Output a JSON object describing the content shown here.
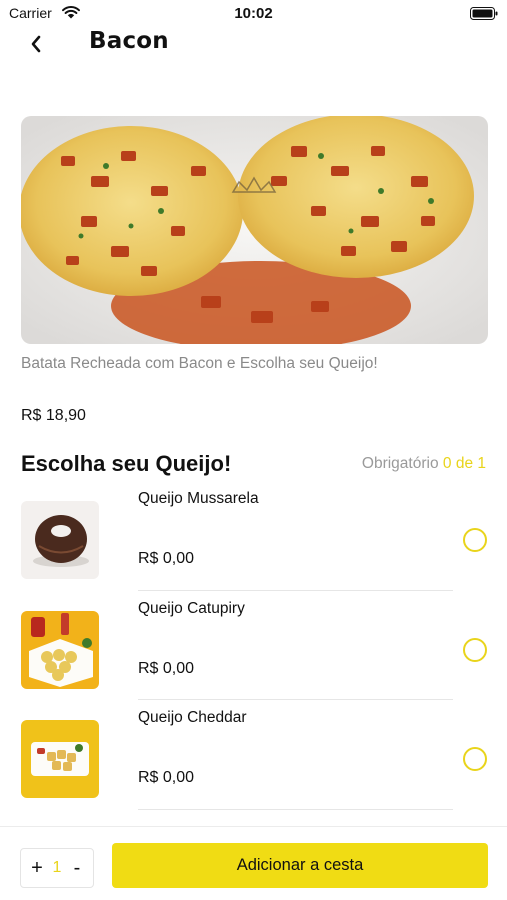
{
  "status_bar": {
    "carrier": "Carrier",
    "time": "10:02"
  },
  "header": {
    "title": "Bacon"
  },
  "product": {
    "description": "Batata Recheada com Bacon e Escolha seu Queijo!",
    "price": "R$ 18,90"
  },
  "section": {
    "title": "Escolha seu Queijo!",
    "required_label": "Obrigatório",
    "required_count": "0 de 1"
  },
  "options": [
    {
      "name": "Queijo Mussarela",
      "price": "R$ 0,00"
    },
    {
      "name": "Queijo Catupiry",
      "price": "R$ 0,00"
    },
    {
      "name": "Queijo Cheddar",
      "price": "R$ 0,00"
    }
  ],
  "footer": {
    "plus": "+",
    "quantity": "1",
    "minus": "-",
    "add_button": "Adicionar a cesta"
  },
  "colors": {
    "accent": "#f0dc14",
    "accent_text": "#e9d41b",
    "muted": "#8a8a8a"
  }
}
